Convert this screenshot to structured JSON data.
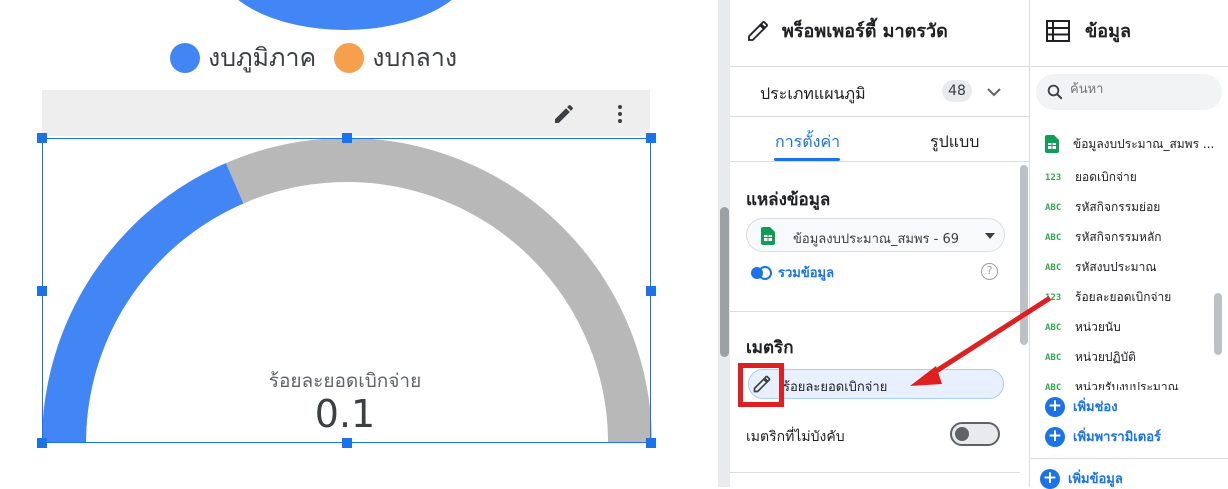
{
  "canvas": {
    "legend": [
      {
        "label": "งบภูมิภาค",
        "color": "#4285f4"
      },
      {
        "label": "งบกลาง",
        "color": "#f6a04d"
      }
    ],
    "gauge": {
      "metric_label": "ร้อยละยอดเบิกจ่าย",
      "value": "0.1",
      "fill_fraction": 0.37,
      "fill_color": "#4285f4",
      "track_color": "#b8b8b8"
    }
  },
  "properties_panel": {
    "title": "พร็อพเพอร์ตี้ มาตรวัด",
    "chart_type": "ประเภทแผนภูมิ",
    "chart_type_count": "48",
    "tabs": [
      {
        "label": "การตั้งค่า",
        "active": true
      },
      {
        "label": "รูปแบบ",
        "active": false
      }
    ],
    "data_source_title": "แหล่งข้อมูล",
    "data_source_value": "ข้อมูลงบประมาณ_สมพร - 69",
    "blend_label": "รวมข้อมูล",
    "help_label": "?",
    "metric_title": "เมตริก",
    "metric_chip": "ร้อยละยอดเบิกจ่าย",
    "optional_metrics_label": "เมตริกที่ไม่บังคับ",
    "optional_metrics_on": false
  },
  "data_panel": {
    "title": "ข้อมูล",
    "search_placeholder": "ค้นหา",
    "data_source_name": "ข้อมูลงบประมาณ_สมพร ...",
    "fields": [
      {
        "type": "123",
        "name": "ยอดเบิกจ่าย"
      },
      {
        "type": "ABC",
        "name": "รหัสกิจกรรมย่อย"
      },
      {
        "type": "ABC",
        "name": "รหัสกิจกรรมหลัก"
      },
      {
        "type": "ABC",
        "name": "รหัสงบประมาณ"
      },
      {
        "type": "123",
        "name": "ร้อยละยอดเบิกจ่าย"
      },
      {
        "type": "ABC",
        "name": "หน่วยนับ"
      },
      {
        "type": "ABC",
        "name": "หน่วยปฏิบัติ"
      },
      {
        "type": "ABC",
        "name": "หน่วยรับงบประมาณ"
      }
    ],
    "add_field": "เพิ่มช่อง",
    "add_parameter": "เพิ่มพารามิเตอร์",
    "add_data": "เพิ่มข้อมูล"
  }
}
